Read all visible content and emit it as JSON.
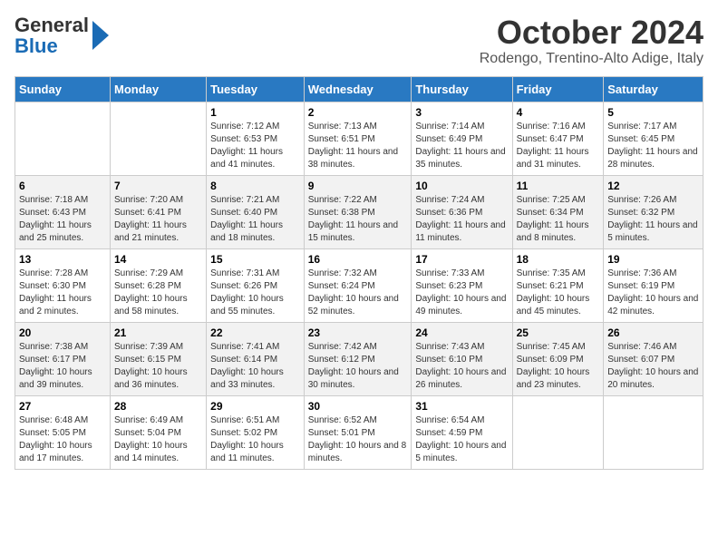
{
  "header": {
    "logo_line1": "General",
    "logo_line2": "Blue",
    "title": "October 2024",
    "subtitle": "Rodengo, Trentino-Alto Adige, Italy"
  },
  "days_of_week": [
    "Sunday",
    "Monday",
    "Tuesday",
    "Wednesday",
    "Thursday",
    "Friday",
    "Saturday"
  ],
  "weeks": [
    [
      {
        "day": "",
        "info": ""
      },
      {
        "day": "",
        "info": ""
      },
      {
        "day": "1",
        "info": "Sunrise: 7:12 AM\nSunset: 6:53 PM\nDaylight: 11 hours and 41 minutes."
      },
      {
        "day": "2",
        "info": "Sunrise: 7:13 AM\nSunset: 6:51 PM\nDaylight: 11 hours and 38 minutes."
      },
      {
        "day": "3",
        "info": "Sunrise: 7:14 AM\nSunset: 6:49 PM\nDaylight: 11 hours and 35 minutes."
      },
      {
        "day": "4",
        "info": "Sunrise: 7:16 AM\nSunset: 6:47 PM\nDaylight: 11 hours and 31 minutes."
      },
      {
        "day": "5",
        "info": "Sunrise: 7:17 AM\nSunset: 6:45 PM\nDaylight: 11 hours and 28 minutes."
      }
    ],
    [
      {
        "day": "6",
        "info": "Sunrise: 7:18 AM\nSunset: 6:43 PM\nDaylight: 11 hours and 25 minutes."
      },
      {
        "day": "7",
        "info": "Sunrise: 7:20 AM\nSunset: 6:41 PM\nDaylight: 11 hours and 21 minutes."
      },
      {
        "day": "8",
        "info": "Sunrise: 7:21 AM\nSunset: 6:40 PM\nDaylight: 11 hours and 18 minutes."
      },
      {
        "day": "9",
        "info": "Sunrise: 7:22 AM\nSunset: 6:38 PM\nDaylight: 11 hours and 15 minutes."
      },
      {
        "day": "10",
        "info": "Sunrise: 7:24 AM\nSunset: 6:36 PM\nDaylight: 11 hours and 11 minutes."
      },
      {
        "day": "11",
        "info": "Sunrise: 7:25 AM\nSunset: 6:34 PM\nDaylight: 11 hours and 8 minutes."
      },
      {
        "day": "12",
        "info": "Sunrise: 7:26 AM\nSunset: 6:32 PM\nDaylight: 11 hours and 5 minutes."
      }
    ],
    [
      {
        "day": "13",
        "info": "Sunrise: 7:28 AM\nSunset: 6:30 PM\nDaylight: 11 hours and 2 minutes."
      },
      {
        "day": "14",
        "info": "Sunrise: 7:29 AM\nSunset: 6:28 PM\nDaylight: 10 hours and 58 minutes."
      },
      {
        "day": "15",
        "info": "Sunrise: 7:31 AM\nSunset: 6:26 PM\nDaylight: 10 hours and 55 minutes."
      },
      {
        "day": "16",
        "info": "Sunrise: 7:32 AM\nSunset: 6:24 PM\nDaylight: 10 hours and 52 minutes."
      },
      {
        "day": "17",
        "info": "Sunrise: 7:33 AM\nSunset: 6:23 PM\nDaylight: 10 hours and 49 minutes."
      },
      {
        "day": "18",
        "info": "Sunrise: 7:35 AM\nSunset: 6:21 PM\nDaylight: 10 hours and 45 minutes."
      },
      {
        "day": "19",
        "info": "Sunrise: 7:36 AM\nSunset: 6:19 PM\nDaylight: 10 hours and 42 minutes."
      }
    ],
    [
      {
        "day": "20",
        "info": "Sunrise: 7:38 AM\nSunset: 6:17 PM\nDaylight: 10 hours and 39 minutes."
      },
      {
        "day": "21",
        "info": "Sunrise: 7:39 AM\nSunset: 6:15 PM\nDaylight: 10 hours and 36 minutes."
      },
      {
        "day": "22",
        "info": "Sunrise: 7:41 AM\nSunset: 6:14 PM\nDaylight: 10 hours and 33 minutes."
      },
      {
        "day": "23",
        "info": "Sunrise: 7:42 AM\nSunset: 6:12 PM\nDaylight: 10 hours and 30 minutes."
      },
      {
        "day": "24",
        "info": "Sunrise: 7:43 AM\nSunset: 6:10 PM\nDaylight: 10 hours and 26 minutes."
      },
      {
        "day": "25",
        "info": "Sunrise: 7:45 AM\nSunset: 6:09 PM\nDaylight: 10 hours and 23 minutes."
      },
      {
        "day": "26",
        "info": "Sunrise: 7:46 AM\nSunset: 6:07 PM\nDaylight: 10 hours and 20 minutes."
      }
    ],
    [
      {
        "day": "27",
        "info": "Sunrise: 6:48 AM\nSunset: 5:05 PM\nDaylight: 10 hours and 17 minutes."
      },
      {
        "day": "28",
        "info": "Sunrise: 6:49 AM\nSunset: 5:04 PM\nDaylight: 10 hours and 14 minutes."
      },
      {
        "day": "29",
        "info": "Sunrise: 6:51 AM\nSunset: 5:02 PM\nDaylight: 10 hours and 11 minutes."
      },
      {
        "day": "30",
        "info": "Sunrise: 6:52 AM\nSunset: 5:01 PM\nDaylight: 10 hours and 8 minutes."
      },
      {
        "day": "31",
        "info": "Sunrise: 6:54 AM\nSunset: 4:59 PM\nDaylight: 10 hours and 5 minutes."
      },
      {
        "day": "",
        "info": ""
      },
      {
        "day": "",
        "info": ""
      }
    ]
  ]
}
